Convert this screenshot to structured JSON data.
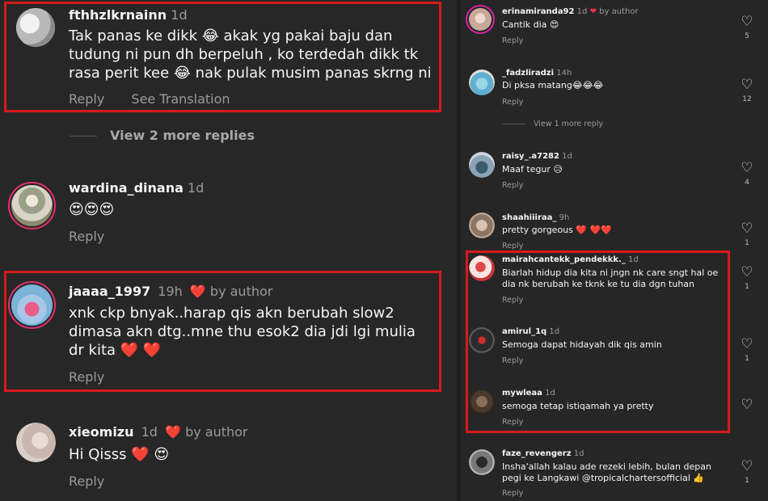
{
  "left": {
    "c1": {
      "username": "fthhzlkrnainn",
      "time": "1d",
      "text": "Tak panas ke dikk 😂 akak yg pakai baju dan tudung ni pun dh berpeluh , ko terdedah dikk tk rasa perit kee 😂 nak pulak musim panas skrng ni",
      "reply": "Reply",
      "see_translation": "See Translation"
    },
    "view_more": "View 2 more replies",
    "c2": {
      "username": "wardina_dinana",
      "time": "1d",
      "text": "😍😍😍",
      "reply": "Reply"
    },
    "c3": {
      "username": "jaaaa_1997",
      "time": "19h",
      "author_heart": "❤️",
      "author_label": "by author",
      "text": "xnk ckp bnyak..harap qis akn berubah slow2 dimasa akn dtg..mne thu esok2 dia jdi lgi mulia dr kita ❤️ ❤️",
      "reply": "Reply"
    },
    "c4": {
      "username": "xieomizu",
      "time": "1d",
      "author_heart": "❤️",
      "author_label": "by author",
      "text": "Hi Qisss ❤️ 😍",
      "reply": "Reply"
    }
  },
  "right": {
    "c1": {
      "username": "erinamiranda92",
      "time": "1d",
      "author_label": "by author",
      "text": "Cantik dia 😍",
      "reply": "Reply",
      "likes": "5"
    },
    "c2": {
      "username": "_fadzliradzi",
      "time": "14h",
      "text": "Di pksa matang😂😂😂",
      "reply": "Reply",
      "likes": "12"
    },
    "view_more": "View 1 more reply",
    "c3": {
      "username": "raisy_.a7282",
      "time": "1d",
      "text": "Maaf tegur 😥",
      "reply": "Reply",
      "likes": "4"
    },
    "c4": {
      "username": "shaahiiiraa_",
      "time": "9h",
      "text": "pretty gorgeous ❤️ ❤️❤️",
      "reply": "Reply",
      "likes": "1"
    },
    "c5": {
      "username": "mairahcantekk_pendekkk._",
      "time": "1d",
      "text": "Biarlah hidup dia kita ni jngn nk care sngt hal oe dia nk berubah ke tknk ke tu dia dgn tuhan",
      "reply": "Reply",
      "likes": "1"
    },
    "c6": {
      "username": "amirul_1q",
      "time": "1d",
      "text": "Semoga dapat hidayah dik qis amin",
      "reply": "Reply",
      "likes": "1"
    },
    "c7": {
      "username": "mywleaa",
      "time": "1d",
      "text": "semoga tetap istiqamah ya pretty",
      "reply": "Reply"
    },
    "c8": {
      "username": "faze_revengerz",
      "time": "1d",
      "text": "Insha'allah kalau ade rezeki lebih, bulan depan pegi ke Langkawi @tropicalchartersofficial 👍",
      "reply": "Reply",
      "likes": "1"
    }
  },
  "colors": {
    "highlight": "#d71a1a",
    "heart": "#ff3040",
    "background": "#262626"
  }
}
